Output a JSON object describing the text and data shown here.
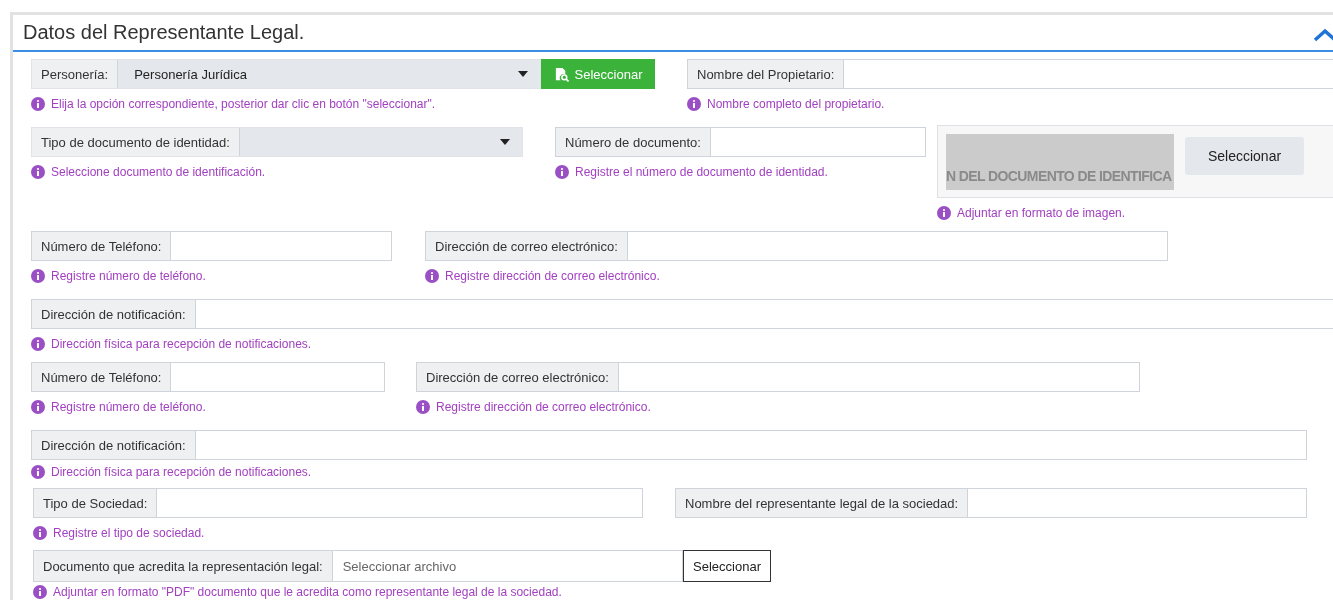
{
  "section": {
    "title": "Datos del Representante Legal.",
    "expanded": true
  },
  "personeria": {
    "label": "Personería:",
    "value": "Personería Jurídica",
    "button": "Seleccionar",
    "hint": "Elija la opción correspondiente, posterior dar clic en botón \"seleccionar\"."
  },
  "propietario": {
    "label": "Nombre del Propietario:",
    "hint": "Nombre completo del propietario."
  },
  "tipo_documento": {
    "label": "Tipo de documento de identidad:",
    "hint": "Seleccione documento de identificación."
  },
  "numero_documento": {
    "label": "Número de documento:",
    "hint": "Registre el número de documento de identidad."
  },
  "imagen_documento": {
    "picture_text": "N DEL DOCUMENTO DE IDENTIFICA",
    "button": "Seleccionar",
    "hint": "Adjuntar en formato de imagen."
  },
  "contactos": [
    {
      "telefono": {
        "label": "Número de Teléfono:",
        "hint": "Registre número de teléfono."
      },
      "correo": {
        "label": "Dirección de correo electrónico:",
        "hint": "Registre dirección de correo electrónico."
      },
      "notificacion": {
        "label": "Dirección de notificación:",
        "hint": "Dirección física para recepción de notificaciones."
      }
    },
    {
      "telefono": {
        "label": "Número de Teléfono:",
        "hint": "Registre número de teléfono."
      },
      "correo": {
        "label": "Dirección de correo electrónico:",
        "hint": "Registre dirección de correo electrónico."
      },
      "notificacion": {
        "label": "Dirección de notificación:",
        "hint": "Dirección física para recepción de notificaciones."
      }
    }
  ],
  "tipo_sociedad": {
    "label": "Tipo de Sociedad:",
    "hint": "Registre el tipo de sociedad."
  },
  "representante": {
    "label": "Nombre del representante legal de la sociedad:"
  },
  "documento_legal": {
    "label": "Documento que acredita la representación legal:",
    "placeholder": "Seleccionar archivo",
    "button": "Seleccionar",
    "hint": "Adjuntar en formato \"PDF\" documento que le acredita como representante legal de la sociedad."
  }
}
